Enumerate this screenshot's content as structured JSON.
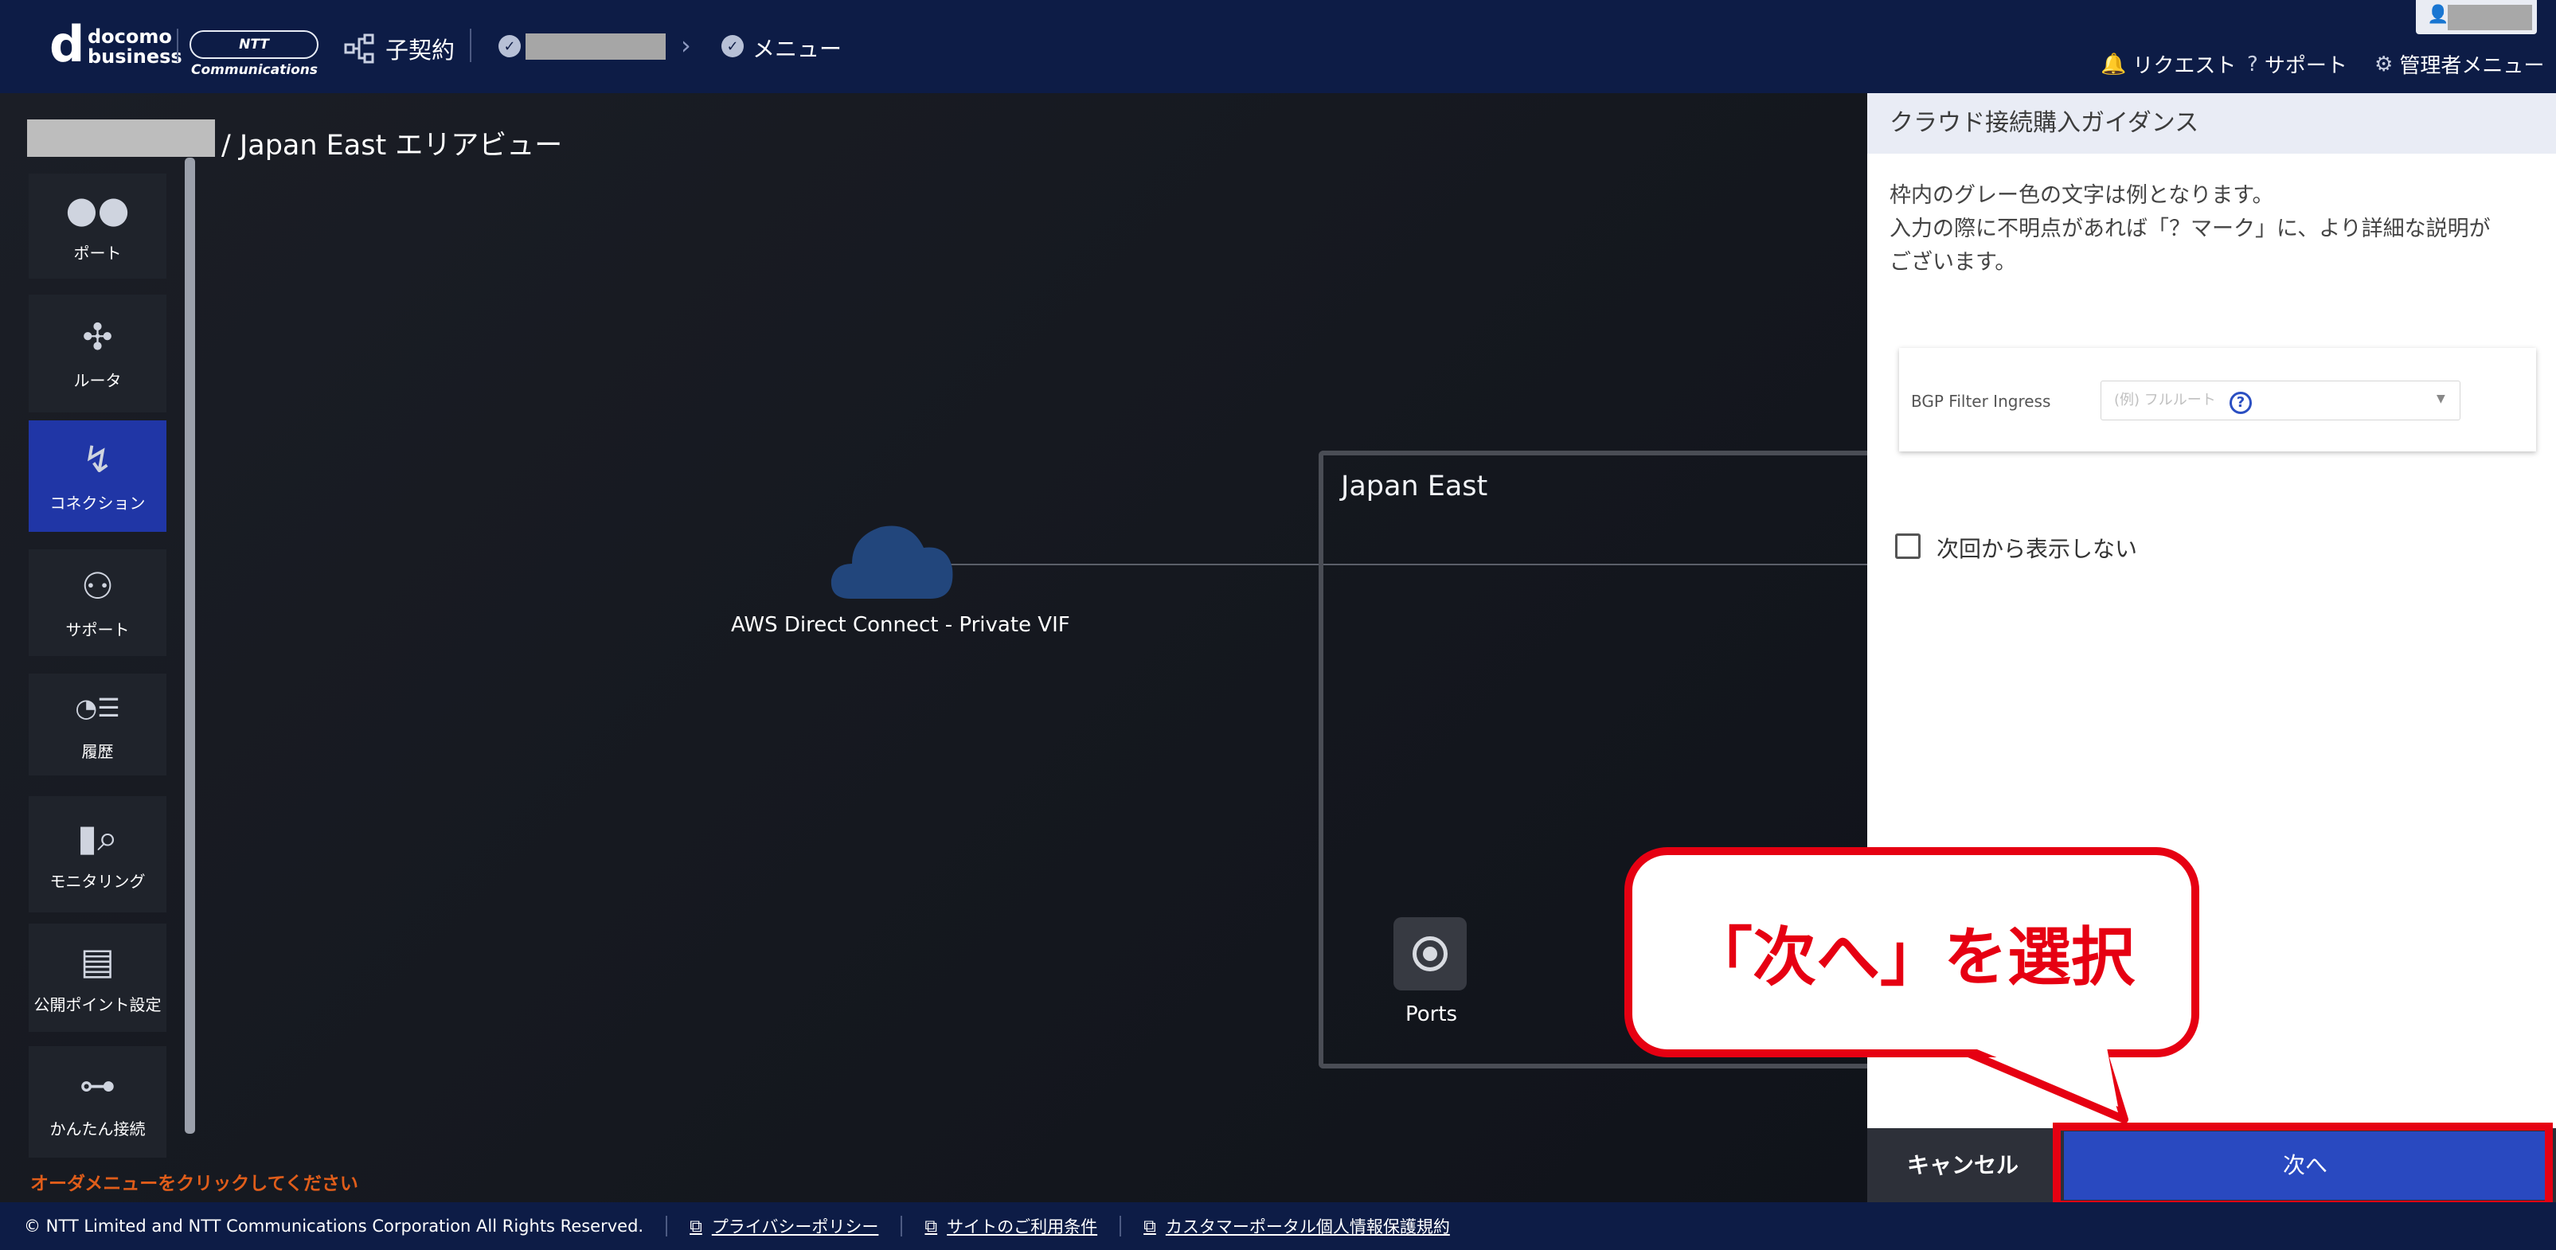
{
  "header": {
    "logo_d": "d",
    "logo_docomo": "docomo",
    "logo_business": "business",
    "ntt_logo": "NTT Communications",
    "subcontract": "子契約",
    "menu": "メニュー",
    "links": [
      "リクエスト",
      "サポート",
      "管理者メニュー"
    ]
  },
  "main": {
    "page_title": "/ Japan East エリアビュー",
    "sidebar": [
      {
        "label": "ポート",
        "icon": "port-icon"
      },
      {
        "label": "ルータ",
        "icon": "router-icon"
      },
      {
        "label": "コネクション",
        "icon": "connection-icon"
      },
      {
        "label": "サポート",
        "icon": "support-user-icon"
      },
      {
        "label": "履歴",
        "icon": "history-icon"
      },
      {
        "label": "モニタリング",
        "icon": "monitoring-icon"
      },
      {
        "label": "公開ポイント設定",
        "icon": "public-point-icon"
      },
      {
        "label": "かんたん接続",
        "icon": "easy-connect-icon"
      }
    ],
    "notice": "オーダメニューをクリックしてください",
    "region": "Japan East",
    "cloud_label": "AWS Direct Connect - Private VIF",
    "ports_label": "Ports"
  },
  "panel": {
    "title": "クラウド接続購入ガイダンス",
    "desc_1": "枠内のグレー色の文字は例となります。",
    "desc_2": "入力の際に不明点があれば「？マーク」に、より詳細な説明が",
    "desc_3": "ございます。",
    "bgp_label": "BGP Filter Ingress",
    "bgp_placeholder": "(例) フルルート",
    "checkbox_label": "次回から表示しない",
    "cancel": "キャンセル",
    "next": "次へ"
  },
  "callout": "「次へ」を選択",
  "footer": {
    "copyright": "© NTT Limited and NTT Communications Corporation All Rights Reserved.",
    "links": [
      "プライバシーポリシー",
      "サイトのご利用条件",
      "カスタマーポータル個人情報保護規約"
    ]
  },
  "colors": {
    "header_bg": "#0d1c46",
    "accent_blue": "#2949c0",
    "callout_red": "#e60012",
    "notice_orange": "#e05d1a"
  }
}
